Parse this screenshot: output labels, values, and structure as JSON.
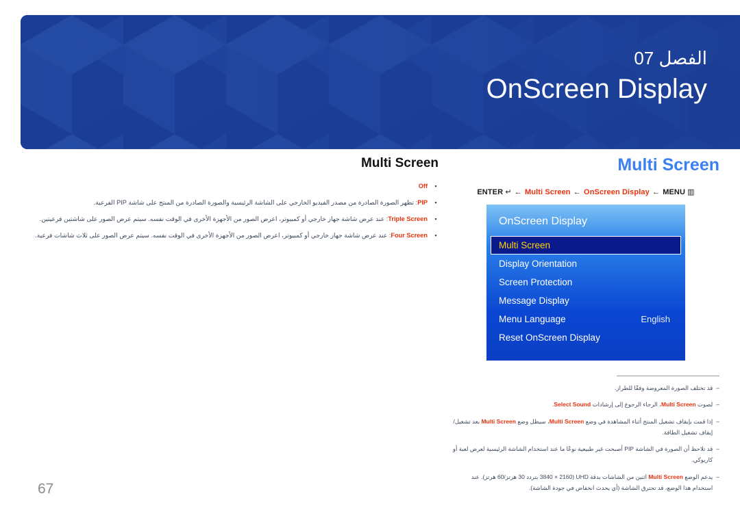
{
  "header": {
    "chapter": "الفصل 07",
    "title": "OnScreen Display",
    "bg_color": "#1b3d96"
  },
  "page": {
    "number": "67"
  },
  "left": {
    "heading": "Multi Screen",
    "bullets": [
      {
        "term": "Off",
        "text": ""
      },
      {
        "term": "PIP",
        "text": ": تظهر الصورة الصادرة من مصدر الفيديو الخارجي على الشاشة الرئيسية والصورة الصادرة من المنتج على شاشة PIP الفرعية."
      },
      {
        "term": "Triple Screen",
        "text": ": عند عرض شاشة جهاز خارجي أو كمبيوتر، اعرض الصور من الأجهزة الأخرى في الوقت نفسه. سيتم عرض الصور على شاشتين فرعيتين."
      },
      {
        "term": "Four Screen",
        "text": ": عند عرض شاشة جهاز خارجي أو كمبيوتر، اعرض الصور من الأجهزة الأخرى في الوقت نفسه. سيتم عرض الصور على ثلاث شاشات فرعية."
      }
    ]
  },
  "right": {
    "heading": "Multi Screen",
    "menu_path": {
      "enter_label": "ENTER",
      "enter_glyph": "↵",
      "arrow": "←",
      "item1": "Multi Screen",
      "item2": "OnScreen Display",
      "menu_label": "MENU",
      "menu_glyph": "▥"
    },
    "osd": {
      "title": "OnScreen Display",
      "rows": [
        {
          "label": "Multi Screen",
          "value": "",
          "selected": true
        },
        {
          "label": "Display Orientation",
          "value": "",
          "selected": false
        },
        {
          "label": "Screen Protection",
          "value": "",
          "selected": false
        },
        {
          "label": "Message Display",
          "value": "",
          "selected": false
        },
        {
          "label": "Menu Language",
          "value": "English",
          "selected": false
        },
        {
          "label": "Reset OnScreen Display",
          "value": "",
          "selected": false
        }
      ],
      "highlight_bg": "#0a1a8c",
      "highlight_text": "#ffd400"
    },
    "notes": [
      {
        "dash": "‒",
        "text": "قد تختلف الصورة المعروضة وفقًا للطراز."
      },
      {
        "dash": "‒",
        "text": "لصوت Multi Screen، الرجاء الرجوع إلى إرشادات Select Sound."
      },
      {
        "dash": "‒",
        "text": "إذا قمت بإيقاف تشغيل المنتج أثناء المشاهدة في وضع Multi Screen، سيظل وضع Multi Screen بعد تشغيل/إيقاف تشغيل الطاقة."
      },
      {
        "dash": "‒",
        "text": "قد تلاحظ أن الصورة في الشاشة PIP أصبحت غير طبيعية نوعًا ما عند استخدام الشاشة الرئيسية لعرض لعبة أو كاريوكي."
      },
      {
        "dash": "‒",
        "text": "يدعم الوضع Multi Screen اثنين من الشاشات بدقة UHD (3840 × 2160 بتردد 30 هرتز/60 هرتز). عند استخدام هذا الوضع، قد تحترق الشاشة (أي يحدث انخفاض في جودة الشاشة)."
      }
    ]
  }
}
